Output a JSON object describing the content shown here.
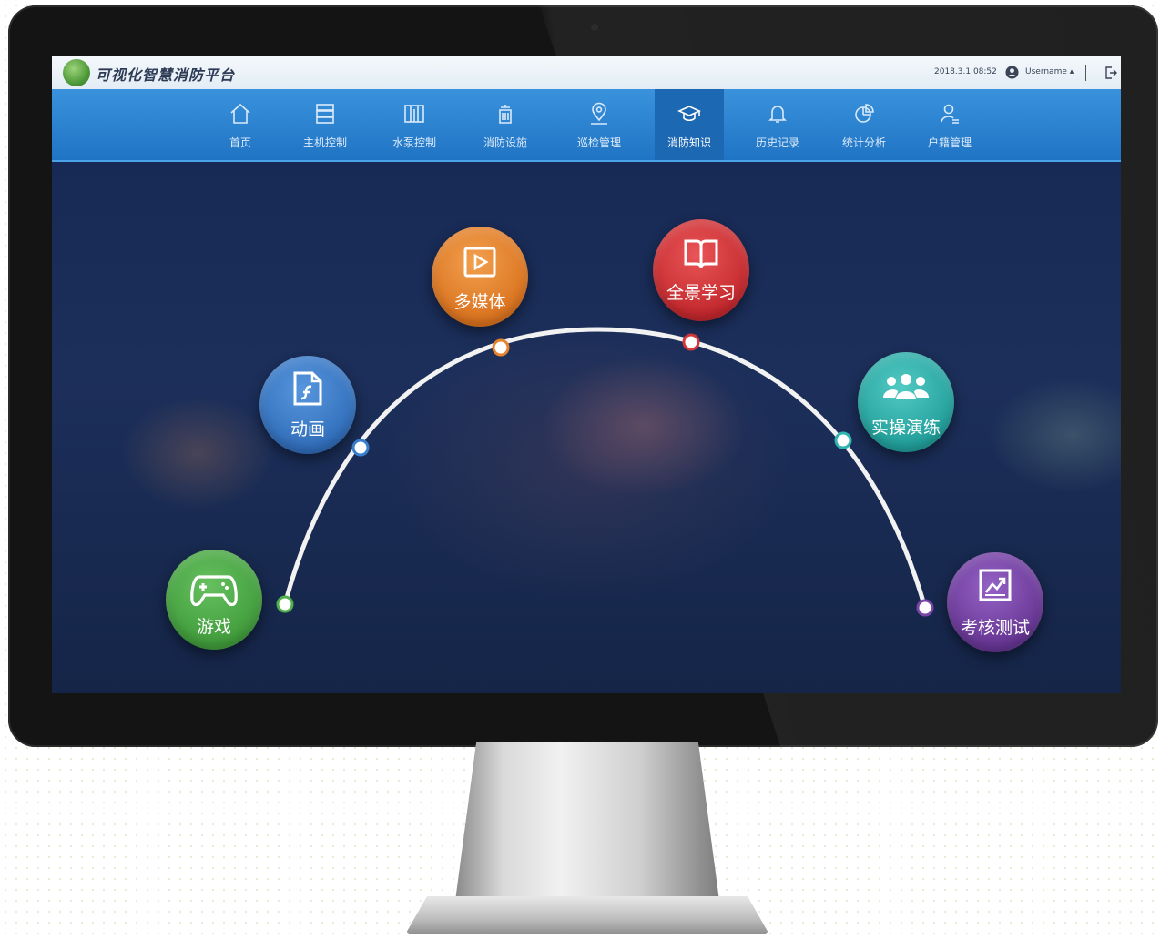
{
  "app": {
    "title": "可视化智慧消防平台",
    "datetime": "2018.3.1 08:52",
    "username": "Username",
    "user_icon": "user-circle-icon",
    "logout_icon": "logout-icon"
  },
  "nav": [
    {
      "label": "首页",
      "icon": "home-icon",
      "active": false
    },
    {
      "label": "主机控制",
      "icon": "server-icon",
      "active": false
    },
    {
      "label": "水泵控制",
      "icon": "pump-icon",
      "active": false
    },
    {
      "label": "消防设施",
      "icon": "facility-icon",
      "active": false
    },
    {
      "label": "巡检管理",
      "icon": "location-pin-icon",
      "active": false
    },
    {
      "label": "消防知识",
      "icon": "graduation-cap-icon",
      "active": true
    },
    {
      "label": "历史记录",
      "icon": "bell-icon",
      "active": false
    },
    {
      "label": "统计分析",
      "icon": "pie-chart-icon",
      "active": false
    },
    {
      "label": "户籍管理",
      "icon": "person-icon",
      "active": false
    }
  ],
  "modules": [
    {
      "label": "游戏",
      "icon": "gamepad-icon",
      "color": "#4faf4a"
    },
    {
      "label": "动画",
      "icon": "flash-file-icon",
      "color": "#3b80cf"
    },
    {
      "label": "多媒体",
      "icon": "video-play-icon",
      "color": "#e8842d"
    },
    {
      "label": "全景学习",
      "icon": "open-book-icon",
      "color": "#d8383a"
    },
    {
      "label": "实操演练",
      "icon": "group-users-icon",
      "color": "#2fb4b0"
    },
    {
      "label": "考核测试",
      "icon": "line-chart-icon",
      "color": "#7b46a8"
    }
  ]
}
